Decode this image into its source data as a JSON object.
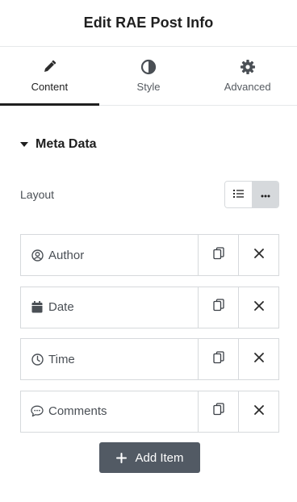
{
  "header": {
    "title": "Edit RAE Post Info"
  },
  "tabs": [
    {
      "label": "Content",
      "icon": "pencil-icon",
      "active": true
    },
    {
      "label": "Style",
      "icon": "half-circle-icon",
      "active": false
    },
    {
      "label": "Advanced",
      "icon": "gear-icon",
      "active": false
    }
  ],
  "section": {
    "title": "Meta Data",
    "expanded": true
  },
  "layout": {
    "label": "Layout",
    "options": [
      "list-icon",
      "more-horizontal-icon"
    ],
    "selected": 1
  },
  "items": [
    {
      "label": "Author",
      "icon": "user-circle-icon"
    },
    {
      "label": "Date",
      "icon": "calendar-icon"
    },
    {
      "label": "Time",
      "icon": "clock-icon"
    },
    {
      "label": "Comments",
      "icon": "comment-icon"
    }
  ],
  "add_button": {
    "label": "Add Item"
  },
  "colors": {
    "accent": "#1f1f1f",
    "button_bg": "#525a64",
    "border": "#d6d9dc",
    "selected_bg": "#d6d9dc"
  }
}
